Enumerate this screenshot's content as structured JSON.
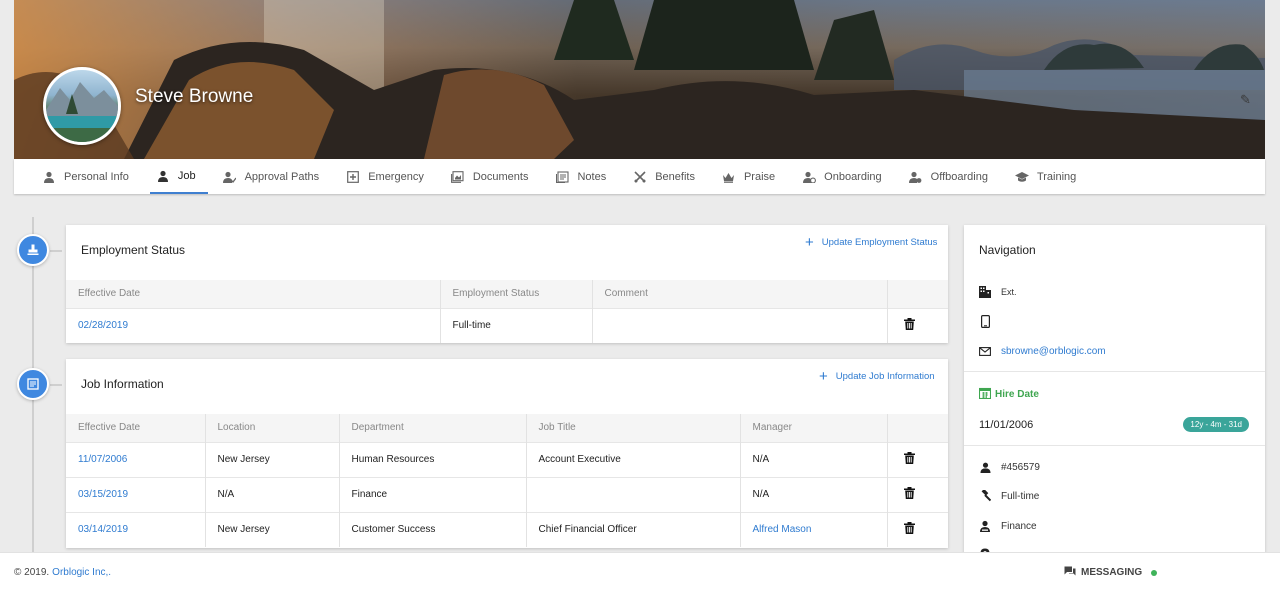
{
  "profile": {
    "name": "Steve Browne"
  },
  "tabs": [
    {
      "label": "Personal Info",
      "icon": "user-icon"
    },
    {
      "label": "Job",
      "icon": "user-icon",
      "active": true
    },
    {
      "label": "Approval Paths",
      "icon": "approval-icon"
    },
    {
      "label": "Emergency",
      "icon": "emergency-icon"
    },
    {
      "label": "Documents",
      "icon": "documents-icon"
    },
    {
      "label": "Notes",
      "icon": "notes-icon"
    },
    {
      "label": "Benefits",
      "icon": "benefits-icon"
    },
    {
      "label": "Praise",
      "icon": "praise-icon"
    },
    {
      "label": "Onboarding",
      "icon": "onboarding-icon"
    },
    {
      "label": "Offboarding",
      "icon": "offboarding-icon"
    },
    {
      "label": "Training",
      "icon": "graduation-cap-icon"
    }
  ],
  "employment_status": {
    "title": "Employment Status",
    "action": "Update Employment Status",
    "columns": [
      "Effective Date",
      "Employment Status",
      "Comment",
      ""
    ],
    "rows": [
      {
        "date": "02/28/2019",
        "status": "Full-time",
        "comment": ""
      }
    ]
  },
  "job_information": {
    "title": "Job Information",
    "action": "Update Job Information",
    "columns": [
      "Effective Date",
      "Location",
      "Department",
      "Job Title",
      "Manager",
      ""
    ],
    "rows": [
      {
        "date": "11/07/2006",
        "location": "New Jersey",
        "department": "Human Resources",
        "job_title": "Account Executive",
        "manager": "N/A",
        "manager_link": false
      },
      {
        "date": "03/15/2019",
        "location": "N/A",
        "department": "Finance",
        "job_title": "",
        "manager": "N/A",
        "manager_link": false
      },
      {
        "date": "03/14/2019",
        "location": "New Jersey",
        "department": "Customer Success",
        "job_title": "Chief Financial Officer",
        "manager": "Alfred Mason",
        "manager_link": true
      }
    ]
  },
  "navigation": {
    "title": "Navigation",
    "ext_label": "Ext.",
    "email": "sbrowne@orblogic.com",
    "hire_date_label": "Hire Date",
    "hire_date": "11/01/2006",
    "tenure": "12y - 4m - 31d",
    "employee_id": "#456579",
    "employment_type": "Full-time",
    "department": "Finance"
  },
  "footer": {
    "copyright": "© 2019.",
    "company": "Orblogic Inc,.",
    "messaging": "MESSAGING"
  },
  "colors": {
    "accent": "#2f7bd0",
    "timeline_node": "#3f88e0",
    "hire_green": "#3fa650",
    "tenure_badge": "#3aa59a",
    "online_dot": "#3fb35a"
  }
}
